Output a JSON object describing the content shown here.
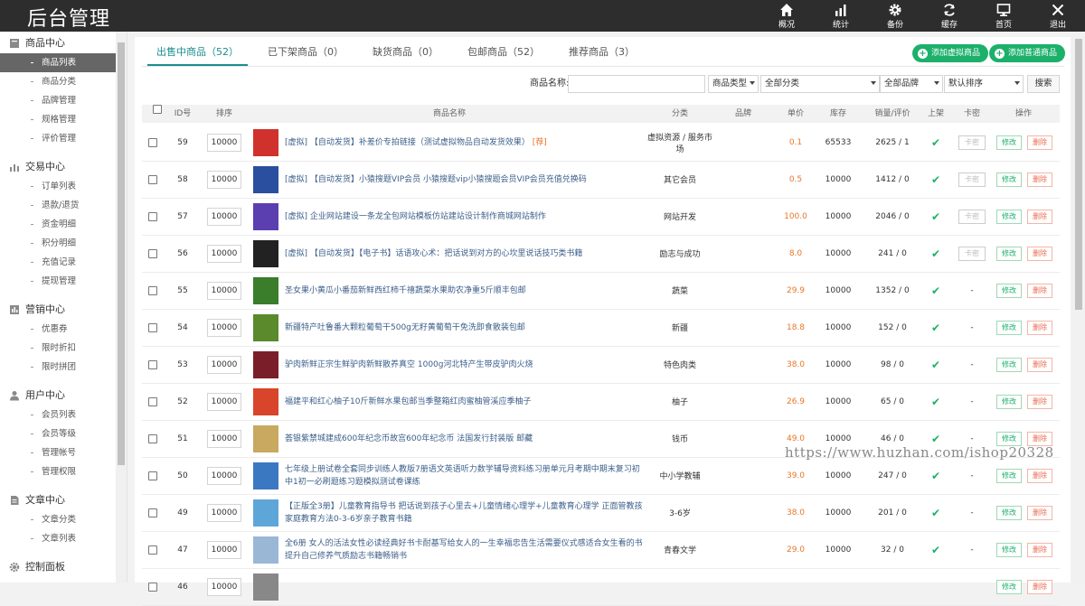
{
  "app": {
    "logo": "后台管理"
  },
  "topnav": [
    {
      "label": "概况",
      "icon": "home-icon"
    },
    {
      "label": "统计",
      "icon": "bar-chart-icon"
    },
    {
      "label": "备份",
      "icon": "gear-icon"
    },
    {
      "label": "缓存",
      "icon": "refresh-icon"
    },
    {
      "label": "首页",
      "icon": "monitor-icon"
    },
    {
      "label": "退出",
      "icon": "close-icon"
    }
  ],
  "sidebar": {
    "groups": [
      {
        "title": "商品中心",
        "icon": "box-icon",
        "items": [
          "商品列表",
          "商品分类",
          "品牌管理",
          "规格管理",
          "评价管理"
        ]
      },
      {
        "title": "交易中心",
        "icon": "chart-icon",
        "items": [
          "订单列表",
          "退款/退货",
          "资金明细",
          "积分明细",
          "充值记录",
          "提现管理"
        ]
      },
      {
        "title": "营销中心",
        "icon": "bar-icon",
        "items": [
          "优惠券",
          "限时折扣",
          "限时拼团"
        ]
      },
      {
        "title": "用户中心",
        "icon": "user-icon",
        "items": [
          "会员列表",
          "会员等级",
          "管理帐号",
          "管理权限"
        ]
      },
      {
        "title": "文章中心",
        "icon": "doc-icon",
        "items": [
          "文章分类",
          "文章列表"
        ]
      },
      {
        "title": "控制面板",
        "icon": "cog-icon",
        "items": []
      }
    ],
    "active": "商品列表"
  },
  "tabs": [
    {
      "label": "出售中商品（52）",
      "active": true
    },
    {
      "label": "已下架商品（0）",
      "active": false
    },
    {
      "label": "缺货商品（0）",
      "active": false
    },
    {
      "label": "包邮商品（52）",
      "active": false
    },
    {
      "label": "推荐商品（3）",
      "active": false
    }
  ],
  "actions": {
    "add_virtual": "添加虚拟商品",
    "add_normal": "添加普通商品"
  },
  "search": {
    "name_label": "商品名称:",
    "name_value": "",
    "type_select": "商品类型",
    "category_select": "全部分类",
    "brand_select": "全部品牌",
    "sort_select": "默认排序",
    "search_button": "搜索"
  },
  "table": {
    "headers": [
      "ID号",
      "排序",
      "商品名称",
      "分类",
      "品牌",
      "单价",
      "库存",
      "销量/评价",
      "上架",
      "卡密",
      "操作"
    ],
    "rows": [
      {
        "id": "59",
        "sort": "10000",
        "name": "[虚拟] 【自动发货】补差价专拍链接（测试虚拟物品自动发货效果）",
        "tag": "[荐]",
        "category": "虚拟资源 / 服务市场",
        "brand": "",
        "price": "0.1",
        "stock": "65533",
        "sales": "2625 / 1",
        "card": "卡密",
        "thumb": "#d0312d"
      },
      {
        "id": "58",
        "sort": "10000",
        "name": "[虚拟] 【自动发货】小猿搜题VIP会员 小猿搜题vip小猿搜题会员VIP会员充值兑换码",
        "tag": "",
        "category": "其它会员",
        "brand": "",
        "price": "0.5",
        "stock": "10000",
        "sales": "1412 / 0",
        "card": "卡密",
        "thumb": "#2a4f9e"
      },
      {
        "id": "57",
        "sort": "10000",
        "name": "[虚拟] 企业网站建设一条龙全包网站模板仿站建站设计制作商城网站制作",
        "tag": "",
        "category": "网站开发",
        "brand": "",
        "price": "100.0",
        "stock": "10000",
        "sales": "2046 / 0",
        "card": "卡密",
        "thumb": "#5b3fb0"
      },
      {
        "id": "56",
        "sort": "10000",
        "name": "[虚拟] 【自动发货】【电子书】话语攻心术：把话说到对方的心坎里说话技巧类书籍",
        "tag": "",
        "category": "励志与成功",
        "brand": "",
        "price": "8.0",
        "stock": "10000",
        "sales": "241 / 0",
        "card": "卡密",
        "thumb": "#222222"
      },
      {
        "id": "55",
        "sort": "10000",
        "name": "圣女果小黄瓜小番茄新鲜西红柿千禧蔬菜水果助农净重5斤顺丰包邮",
        "tag": "",
        "category": "蔬菜",
        "brand": "",
        "price": "29.9",
        "stock": "10000",
        "sales": "1352 / 0",
        "card": "-",
        "thumb": "#3a7d2a"
      },
      {
        "id": "54",
        "sort": "10000",
        "name": "新疆特产吐鲁番大颗粒葡萄干500g无籽黄葡萄干免洗即食散装包邮",
        "tag": "",
        "category": "新疆",
        "brand": "",
        "price": "18.8",
        "stock": "10000",
        "sales": "152 / 0",
        "card": "-",
        "thumb": "#5a8a2b"
      },
      {
        "id": "53",
        "sort": "10000",
        "name": "驴肉新鲜正宗生鲜驴肉新鲜散养真空 1000g河北特产生带皮驴肉火烧",
        "tag": "",
        "category": "特色肉类",
        "brand": "",
        "price": "38.0",
        "stock": "10000",
        "sales": "98 / 0",
        "card": "-",
        "thumb": "#7a1f2a"
      },
      {
        "id": "52",
        "sort": "10000",
        "name": "福建平和红心柚子10斤新鲜水果包邮当季整箱红肉蜜柚管溪应季柚子",
        "tag": "",
        "category": "柚子",
        "brand": "",
        "price": "26.9",
        "stock": "10000",
        "sales": "65 / 0",
        "card": "-",
        "thumb": "#d8452b"
      },
      {
        "id": "51",
        "sort": "10000",
        "name": "荟银紫禁城建成600年纪念币故宫600年纪念币 法国发行封装版 邮藏",
        "tag": "",
        "category": "钱币",
        "brand": "",
        "price": "49.0",
        "stock": "10000",
        "sales": "46 / 0",
        "card": "-",
        "thumb": "#c9a860"
      },
      {
        "id": "50",
        "sort": "10000",
        "name": "七年级上册试卷全套同步训练人教版7册语文英语听力数学辅导资料练习册单元月考期中期末复习初中1初一必刷题练习题模拟测试卷课练",
        "tag": "",
        "category": "中小学教辅",
        "brand": "",
        "price": "39.0",
        "stock": "10000",
        "sales": "247 / 0",
        "card": "-",
        "thumb": "#3b78c2"
      },
      {
        "id": "49",
        "sort": "10000",
        "name": "【正版全3册】儿童教育指导书 把话说到孩子心里去+儿童情绪心理学+儿童教育心理学 正面管教孩家庭教育方法0-3-6岁亲子教育书籍",
        "tag": "",
        "category": "3-6岁",
        "brand": "",
        "price": "38.0",
        "stock": "10000",
        "sales": "201 / 0",
        "card": "-",
        "thumb": "#5fa6d8"
      },
      {
        "id": "47",
        "sort": "10000",
        "name": "全6册 女人的活法女性必读经典好书卡耐基写给女人的一生幸福忠告生活需要仪式感适合女生看的书提升自己修养气质励志书籍畅销书",
        "tag": "",
        "category": "青春文学",
        "brand": "",
        "price": "29.0",
        "stock": "10000",
        "sales": "32 / 0",
        "card": "-",
        "thumb": "#9ab7d6"
      },
      {
        "id": "46",
        "sort": "10000",
        "name": "",
        "tag": "",
        "category": "",
        "brand": "",
        "price": "",
        "stock": "",
        "sales": "",
        "card": "",
        "thumb": "#888888"
      }
    ],
    "edit_label": "修改",
    "delete_label": "删除"
  },
  "watermark": "https://www.huzhan.com/ishop20328"
}
